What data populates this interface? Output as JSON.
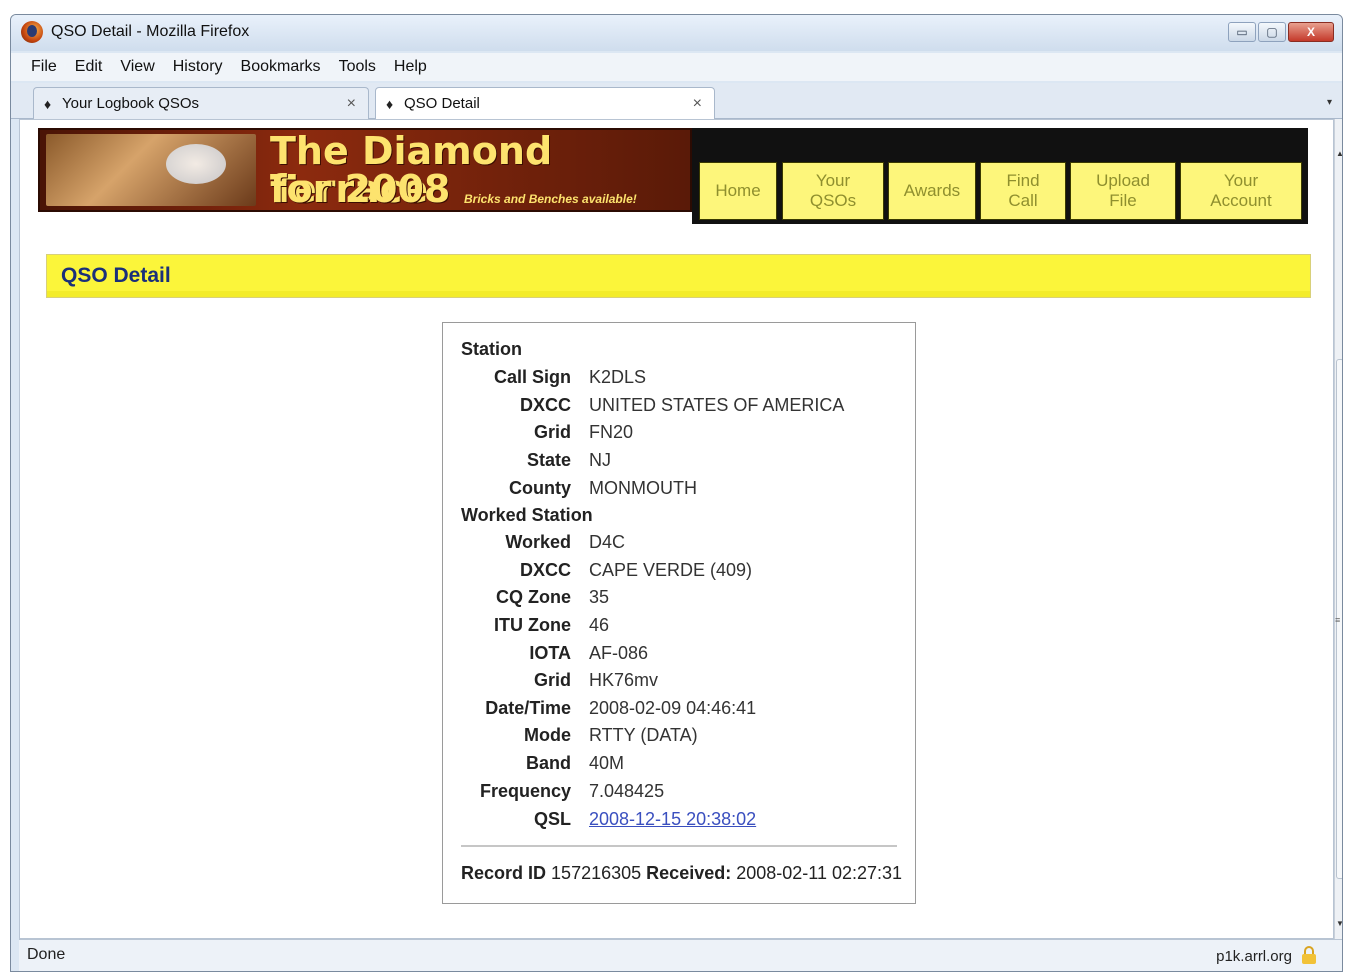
{
  "window": {
    "title": "QSO Detail - Mozilla Firefox",
    "controls": {
      "minimize": "▭",
      "maximize": "▢",
      "close": "X"
    }
  },
  "menubar": [
    "File",
    "Edit",
    "View",
    "History",
    "Bookmarks",
    "Tools",
    "Help"
  ],
  "tabs": [
    {
      "label": "Your Logbook QSOs",
      "icon": "diamond-icon",
      "close": "×"
    },
    {
      "label": "QSO Detail",
      "icon": "diamond-icon",
      "close": "×"
    }
  ],
  "banner": {
    "title": "The Diamond Terrace",
    "year": "for 2008",
    "tagline": "Bricks and Benches available!"
  },
  "nav": [
    {
      "line1": "Home",
      "line2": ""
    },
    {
      "line1": "Your",
      "line2": "QSOs"
    },
    {
      "line1": "Awards",
      "line2": ""
    },
    {
      "line1": "Find",
      "line2": "Call"
    },
    {
      "line1": "Upload",
      "line2": "File"
    },
    {
      "line1": "Your",
      "line2": "Account"
    }
  ],
  "page_heading": "QSO Detail",
  "station": {
    "title": "Station",
    "rows": [
      {
        "label": "Call Sign",
        "value": "K2DLS"
      },
      {
        "label": "DXCC",
        "value": "UNITED STATES OF AMERICA"
      },
      {
        "label": "Grid",
        "value": "FN20"
      },
      {
        "label": "State",
        "value": "NJ"
      },
      {
        "label": "County",
        "value": "MONMOUTH"
      }
    ]
  },
  "worked_station": {
    "title": "Worked Station",
    "rows": [
      {
        "label": "Worked",
        "value": "D4C"
      },
      {
        "label": "DXCC",
        "value": "CAPE VERDE (409)"
      },
      {
        "label": "CQ Zone",
        "value": "35"
      },
      {
        "label": "ITU Zone",
        "value": "46"
      },
      {
        "label": "IOTA",
        "value": "AF-086"
      },
      {
        "label": "Grid",
        "value": "HK76mv"
      },
      {
        "label": "Date/Time",
        "value": "2008-02-09 04:46:41"
      },
      {
        "label": "Mode",
        "value": "RTTY (DATA)"
      },
      {
        "label": "Band",
        "value": "40M"
      },
      {
        "label": "Frequency",
        "value": "7.048425"
      },
      {
        "label": "QSL",
        "value": "2008-12-15 20:38:02"
      }
    ]
  },
  "record": {
    "id_label": "Record ID",
    "id_value": "157216305",
    "received_label": "Received:",
    "received_value": "2008-02-11 02:27:31"
  },
  "statusbar": {
    "status": "Done",
    "domain": "p1k.arrl.org"
  },
  "colors": {
    "heading_bg": "#fbf53a",
    "heading_text": "#1a2f7a",
    "nav_bg": "#fdf67b",
    "link": "#3a4fbf",
    "banner_text": "#fde36e"
  }
}
